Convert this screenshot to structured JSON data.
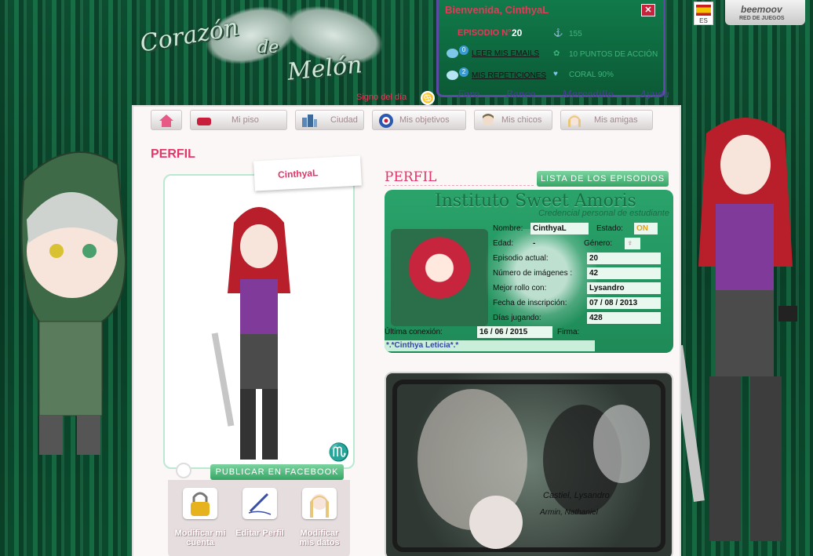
{
  "game": {
    "logo_line1": "Corazón",
    "logo_line2": "de",
    "logo_line3": "Melón",
    "signo_label": "Signo del día",
    "signo_symbol": "♋"
  },
  "welcome": {
    "greeting": "Bienvenida, CinthyaL",
    "close": "✕",
    "episode_label": "EPISODIO N°",
    "episode_number": "20",
    "messages_count": "0",
    "messages_link": "LEER MIS EMAILS",
    "repetitions_count": "2",
    "repetitions_link": "MIS REPETICIONES",
    "dollars": "155",
    "action_points": "10 PUNTOS DE ACCIÓN",
    "coral": "CORAL 90%",
    "links": [
      "Foro",
      "Banco",
      "Mercadillo",
      "Ayuda"
    ]
  },
  "locale": {
    "lang_code": "ES"
  },
  "beemoov": {
    "brand": "beemoov",
    "tagline": "RED DE JUEGOS"
  },
  "nav": [
    "Mi piso",
    "Ciudad",
    "Mis objetivos",
    "Mis chicos",
    "Mis amigas"
  ],
  "profile": {
    "heading": "PERFIL",
    "username": "CinthyaL",
    "zodiac_symbol": "♏",
    "publish_facebook": "PUBLICAR EN FACEBOOK",
    "actions": [
      "Modificar mi cuenta",
      "Editar Perfil",
      "Modificar mis datos"
    ]
  },
  "card": {
    "section_title": "PERFIL",
    "episodes_button": "LISTA DE LOS EPISODIOS",
    "school": "Instituto Sweet Amoris",
    "subtitle": "Credencial personal de estudiante",
    "labels": {
      "nombre": "Nombre:",
      "estado": "Estado:",
      "edad": "Edad:",
      "genero": "Género:",
      "episodio": "Episodio actual:",
      "imagenes": "Número de imágenes :",
      "mejor": "Mejor rollo con:",
      "inscripcion": "Fecha de inscripción:",
      "dias": "Días jugando:",
      "ultima": "Última conexión:",
      "firma": "Firma:"
    },
    "values": {
      "nombre": "CinthyaL",
      "estado": "ON",
      "edad": "-",
      "genero": "♀",
      "episodio": "20",
      "imagenes": "42",
      "mejor": "Lysandro",
      "inscripcion": "07 / 08 / 2013",
      "dias": "428",
      "ultima": "16 / 06 / 2015",
      "firma": "*.*Cinthya Leticia*.*"
    }
  },
  "banner": {
    "line1": "Castiel, Lysandro",
    "line2": "Armin, Nathaniel"
  },
  "colors": {
    "accent_pink": "#e4356a",
    "green_button": "#35a565",
    "background_green": "#0d5634"
  }
}
